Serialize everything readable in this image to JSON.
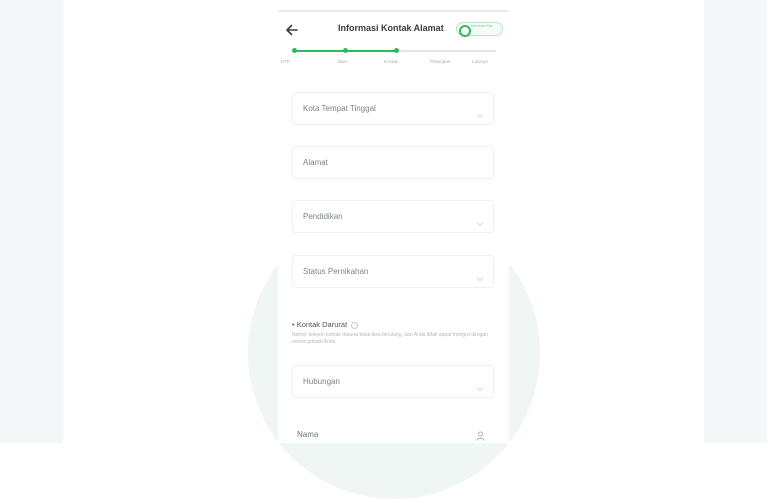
{
  "header": {
    "title": "Informasi Kontak Alamat",
    "toggle_text": "Informasi Kita"
  },
  "stepper": {
    "steps": [
      "KTP",
      "Baru",
      "Kontak",
      "Pekerjaan",
      "Lainnya"
    ],
    "active_steps": 3
  },
  "fields": [
    {
      "label": "Kota Tempat Tinggal",
      "dropdown": true
    },
    {
      "label": "Alamat",
      "dropdown": false
    },
    {
      "label": "Pendidikan",
      "dropdown": true
    },
    {
      "label": "Status Pernikahan",
      "dropdown": true
    }
  ],
  "emergency": {
    "title": "• Kontak Darurat",
    "description": "Nomor telepon kontak darurat tidak bisa berulang, dan Anda tidak dapat mengisi dengan nomor pribadi Anda",
    "relation_label": "Hubungan",
    "name_label": "Nama"
  },
  "colors": {
    "accent": "#2fb85c",
    "panel": "#f4f7f8",
    "circle": "#f0f6f4"
  },
  "icons": [
    "back-arrow-icon",
    "chevron-down-icon",
    "info-icon",
    "contact-person-icon"
  ]
}
